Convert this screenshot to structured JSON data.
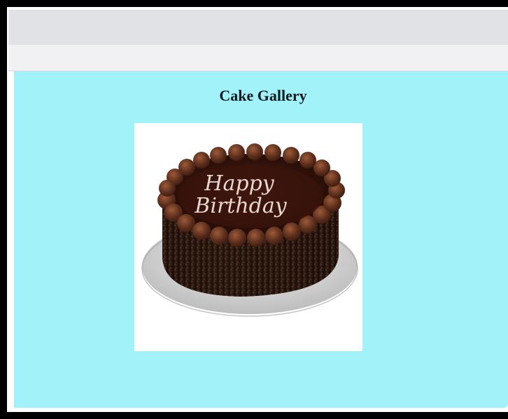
{
  "window": {
    "background": "#000000"
  },
  "browser": {
    "toolbar_color": "#e1e2e6",
    "address_bar_color": "#f1f1f4"
  },
  "page": {
    "background": "#a2f2fa",
    "title": "Cake Gallery"
  },
  "gallery": {
    "image": {
      "icon": "birthday-cake-icon",
      "caption_line1": "Happy",
      "caption_line2": "Birthday"
    }
  }
}
